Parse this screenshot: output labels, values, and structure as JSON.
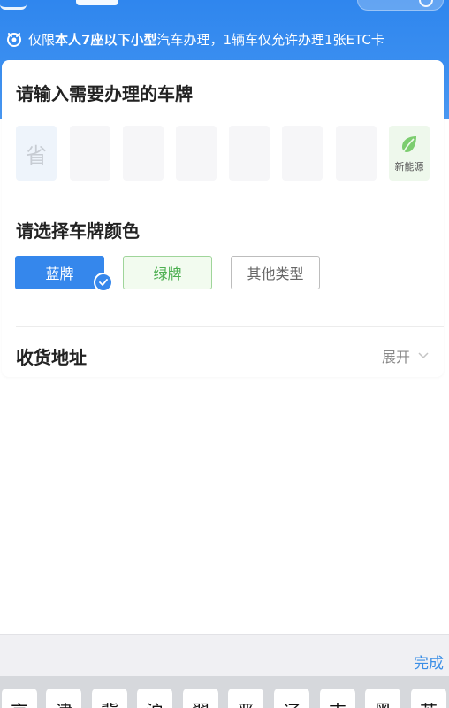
{
  "notice": {
    "prefix": "仅限",
    "bold": "本人7座以下小型",
    "suffix": "汽车办理，1辆车仅允许办理1张ETC卡"
  },
  "plate": {
    "title": "请输入需要办理的车牌",
    "province_placeholder": "省",
    "new_energy_label": "新能源"
  },
  "plate_color": {
    "title": "请选择车牌颜色",
    "options": [
      "蓝牌",
      "绿牌",
      "其他类型"
    ],
    "selected": "蓝牌"
  },
  "address": {
    "label": "收货地址",
    "expand_label": "展开"
  },
  "keyboard": {
    "done_label": "完成",
    "keys": [
      "京",
      "津",
      "冀",
      "沪",
      "翼",
      "晋",
      "辽",
      "吉",
      "黑",
      "苏"
    ]
  },
  "colors": {
    "primary_blue": "#3587ec",
    "green": "#4caf50",
    "link_blue": "#3a8ee6"
  }
}
